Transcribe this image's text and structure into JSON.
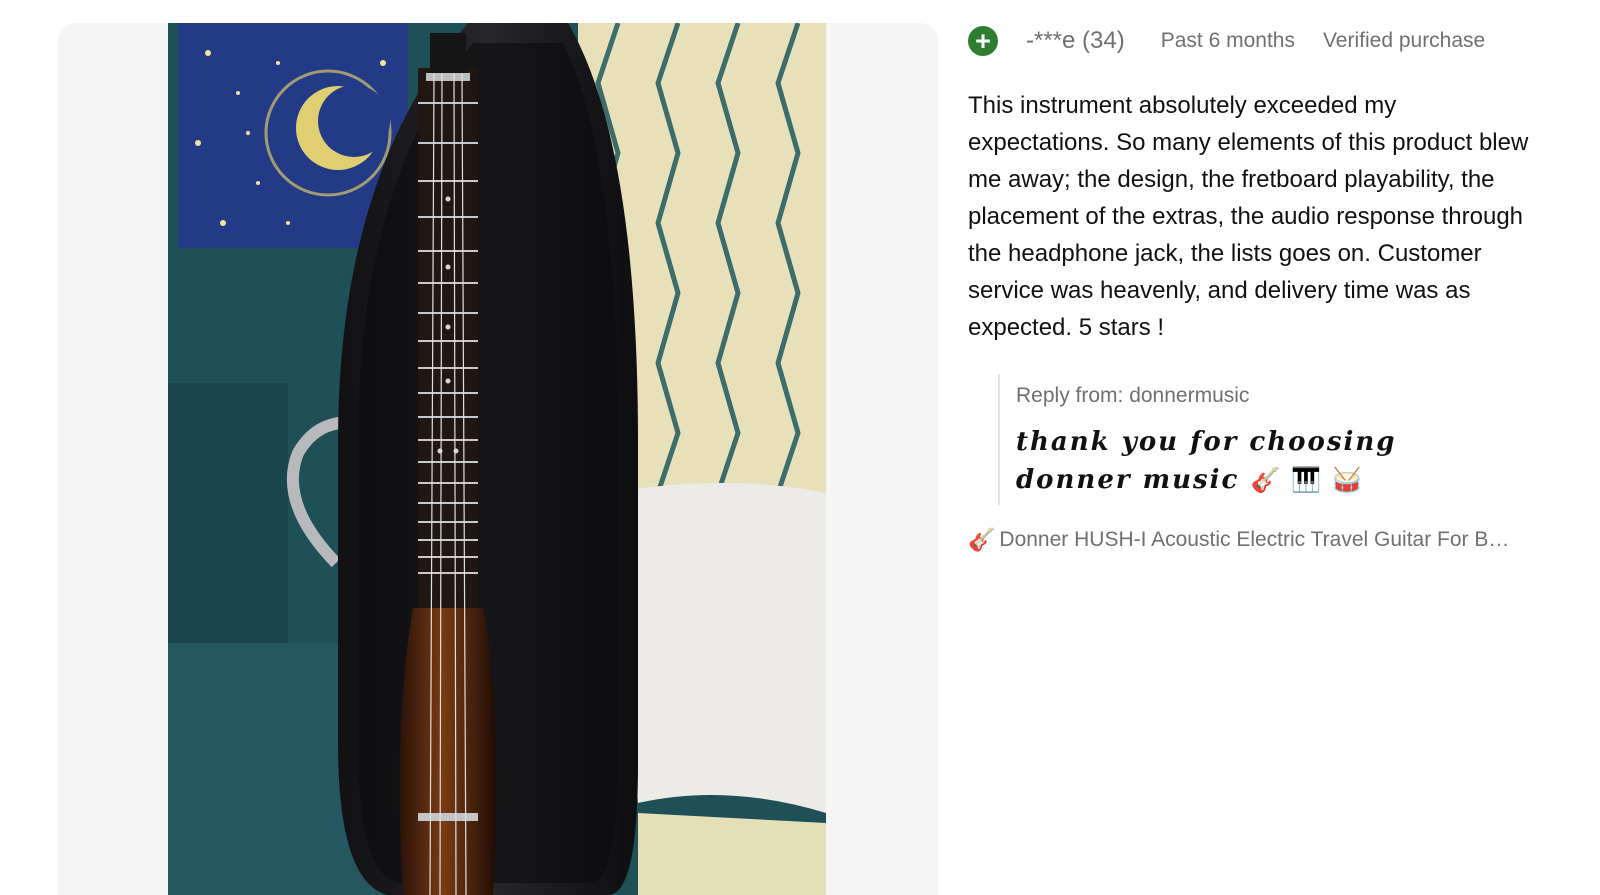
{
  "review": {
    "badge_icon": "plus-circle-icon",
    "badge_color": "#2e7d32",
    "reviewer": "-***e (34)",
    "timeframe": "Past 6 months",
    "verified": "Verified purchase",
    "text": "This instrument absolutely exceeded my expectations. So many elements of this product blew me away; the design, the fretboard playability, the placement of the extras, the audio response through the headphone jack, the lists goes on. Customer service was heavenly, and delivery time was as expected. 5 stars !"
  },
  "reply": {
    "label": "Reply from: donnermusic",
    "text": "thank you for choosing donner music",
    "emojis": [
      "🎸",
      "🎹",
      "🥁"
    ]
  },
  "product": {
    "icon": "🎸",
    "name": "Donner HUSH-I Acoustic Electric Travel Guitar For Beginners Adults Headless"
  },
  "photo": {
    "description_icon": "review-photo-guitar-in-gig-bag"
  }
}
